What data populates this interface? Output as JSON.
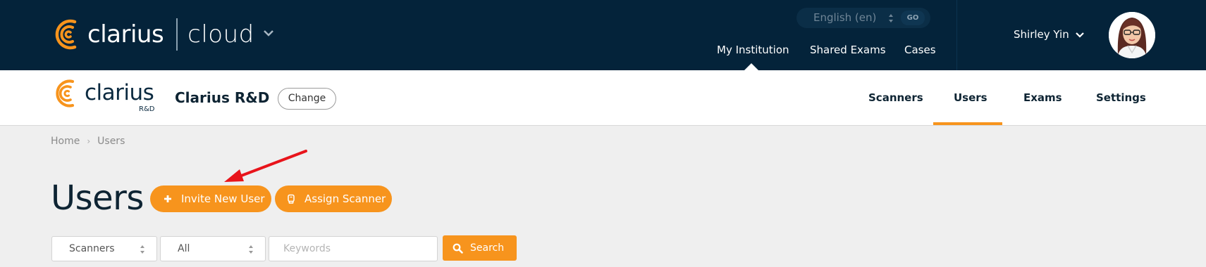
{
  "topbar": {
    "logo_word": "clarius",
    "product_name": "cloud",
    "language": {
      "selected": "English (en)",
      "go_label": "GO"
    },
    "nav": [
      {
        "label": "My Institution",
        "active": true
      },
      {
        "label": "Shared Exams",
        "active": false
      },
      {
        "label": "Cases",
        "active": false
      }
    ],
    "user_name": "Shirley Yin"
  },
  "institution_bar": {
    "logo_word": "clarius",
    "logo_sub": "R&D",
    "institution_name": "Clarius R&D",
    "change_label": "Change",
    "tabs": [
      {
        "label": "Scanners",
        "active": false
      },
      {
        "label": "Users",
        "active": true
      },
      {
        "label": "Exams",
        "active": false
      },
      {
        "label": "Settings",
        "active": false
      }
    ]
  },
  "breadcrumb": {
    "home": "Home",
    "current": "Users"
  },
  "page": {
    "title": "Users",
    "invite_label": "Invite New User",
    "assign_label": "Assign Scanner"
  },
  "filters": {
    "type_selected": "Scanners",
    "status_selected": "All",
    "keyword_placeholder": "Keywords",
    "search_label": "Search"
  },
  "colors": {
    "topbar_bg": "#04233a",
    "accent": "#f7941d",
    "annotation_arrow": "#e8141b"
  },
  "icons": {
    "product_dropdown": "chevron-down-icon",
    "invite": "plus-icon",
    "assign": "scanner-icon",
    "search": "search-icon"
  }
}
